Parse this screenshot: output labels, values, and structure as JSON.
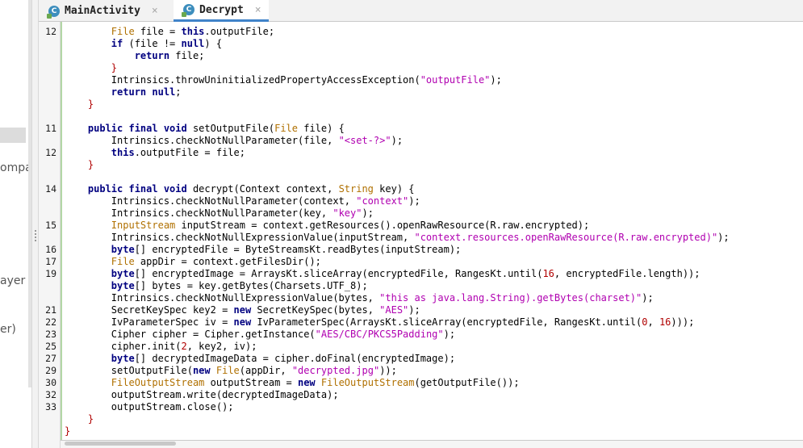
{
  "left_panel": {
    "fragments": [
      "ompa",
      "ayer",
      "er)"
    ]
  },
  "tabs": [
    {
      "label": "MainActivity",
      "close": "×",
      "active": false
    },
    {
      "label": "Decrypt",
      "close": "×",
      "active": true
    }
  ],
  "file_icon_letter": "C",
  "gutter_numbers": [
    {
      "n": "12",
      "line": 0
    },
    {
      "n": "11",
      "line": 8
    },
    {
      "n": "12",
      "line": 10
    },
    {
      "n": "14",
      "line": 13
    },
    {
      "n": "15",
      "line": 16
    },
    {
      "n": "16",
      "line": 18
    },
    {
      "n": "17",
      "line": 19
    },
    {
      "n": "19",
      "line": 20
    },
    {
      "n": "21",
      "line": 23
    },
    {
      "n": "22",
      "line": 24
    },
    {
      "n": "23",
      "line": 25
    },
    {
      "n": "25",
      "line": 26
    },
    {
      "n": "27",
      "line": 27
    },
    {
      "n": "29",
      "line": 28
    },
    {
      "n": "30",
      "line": 29
    },
    {
      "n": "32",
      "line": 30
    },
    {
      "n": "33",
      "line": 31
    }
  ],
  "code_lines": [
    [
      [
        "ty",
        "        File"
      ],
      [
        "t",
        " file = "
      ],
      [
        "kw",
        "this"
      ],
      [
        "t",
        ".outputFile;"
      ]
    ],
    [
      [
        "kw",
        "        if"
      ],
      [
        "t",
        " ("
      ],
      [
        "t",
        "file != "
      ],
      [
        "kw",
        "null"
      ],
      [
        "t",
        ") {"
      ]
    ],
    [
      [
        "kw",
        "            return"
      ],
      [
        "t",
        " file;"
      ]
    ],
    [
      [
        "br",
        "        }"
      ]
    ],
    [
      [
        "t",
        "        Intrinsics.throwUninitializedPropertyAccessException("
      ],
      [
        "st",
        "\"outputFile\""
      ],
      [
        "t",
        ");"
      ]
    ],
    [
      [
        "kw",
        "        return"
      ],
      [
        "t",
        " "
      ],
      [
        "kw",
        "null"
      ],
      [
        "t",
        ";"
      ]
    ],
    [
      [
        "br",
        "    }"
      ]
    ],
    [
      [
        "t",
        ""
      ]
    ],
    [
      [
        "kw",
        "    public final void"
      ],
      [
        "t",
        " setOutputFile("
      ],
      [
        "ty",
        "File"
      ],
      [
        "t",
        " file) {"
      ]
    ],
    [
      [
        "t",
        "        Intrinsics.checkNotNullParameter(file, "
      ],
      [
        "st",
        "\"<set-?>\""
      ],
      [
        "t",
        ");"
      ]
    ],
    [
      [
        "kw",
        "        this"
      ],
      [
        "t",
        ".outputFile = file;"
      ]
    ],
    [
      [
        "br",
        "    }"
      ]
    ],
    [
      [
        "t",
        ""
      ]
    ],
    [
      [
        "kw",
        "    public final void"
      ],
      [
        "t",
        " decrypt(Context context, "
      ],
      [
        "ty",
        "String"
      ],
      [
        "t",
        " key) {"
      ]
    ],
    [
      [
        "t",
        "        Intrinsics.checkNotNullParameter(context, "
      ],
      [
        "st",
        "\"context\""
      ],
      [
        "t",
        ");"
      ]
    ],
    [
      [
        "t",
        "        Intrinsics.checkNotNullParameter(key, "
      ],
      [
        "st",
        "\"key\""
      ],
      [
        "t",
        ");"
      ]
    ],
    [
      [
        "ty",
        "        InputStream"
      ],
      [
        "t",
        " inputStream = context.getResources().openRawResource(R.raw.encrypted);"
      ]
    ],
    [
      [
        "t",
        "        Intrinsics.checkNotNullExpressionValue(inputStream, "
      ],
      [
        "st",
        "\"context.resources.openRawResource(R.raw.encrypted)\""
      ],
      [
        "t",
        ");"
      ]
    ],
    [
      [
        "kw",
        "        byte"
      ],
      [
        "t",
        "[] encryptedFile = ByteStreamsKt.readBytes(inputStream);"
      ]
    ],
    [
      [
        "ty",
        "        File"
      ],
      [
        "t",
        " appDir = context.getFilesDir();"
      ]
    ],
    [
      [
        "kw",
        "        byte"
      ],
      [
        "t",
        "[] encryptedImage = ArraysKt.sliceArray(encryptedFile, RangesKt.until("
      ],
      [
        "br",
        "16"
      ],
      [
        "t",
        ", encryptedFile.length));"
      ]
    ],
    [
      [
        "kw",
        "        byte"
      ],
      [
        "t",
        "[] bytes = key.getBytes(Charsets.UTF_8);"
      ]
    ],
    [
      [
        "t",
        "        Intrinsics.checkNotNullExpressionValue(bytes, "
      ],
      [
        "st",
        "\"this as java.lang.String).getBytes(charset)\""
      ],
      [
        "t",
        ");"
      ]
    ],
    [
      [
        "t",
        "        SecretKeySpec key2 = "
      ],
      [
        "kw",
        "new"
      ],
      [
        "t",
        " SecretKeySpec(bytes, "
      ],
      [
        "st",
        "\"AES\""
      ],
      [
        "t",
        ");"
      ]
    ],
    [
      [
        "t",
        "        IvParameterSpec iv = "
      ],
      [
        "kw",
        "new"
      ],
      [
        "t",
        " IvParameterSpec(ArraysKt.sliceArray(encryptedFile, RangesKt.until("
      ],
      [
        "br",
        "0"
      ],
      [
        "t",
        ", "
      ],
      [
        "br",
        "16"
      ],
      [
        "t",
        ")));"
      ]
    ],
    [
      [
        "t",
        "        Cipher cipher = Cipher.getInstance("
      ],
      [
        "st",
        "\"AES/CBC/PKCS5Padding\""
      ],
      [
        "t",
        ");"
      ]
    ],
    [
      [
        "t",
        "        cipher.init("
      ],
      [
        "br",
        "2"
      ],
      [
        "t",
        ", key2, iv);"
      ]
    ],
    [
      [
        "kw",
        "        byte"
      ],
      [
        "t",
        "[] decryptedImageData = cipher.doFinal(encryptedImage);"
      ]
    ],
    [
      [
        "t",
        "        setOutputFile("
      ],
      [
        "kw",
        "new"
      ],
      [
        "t",
        " "
      ],
      [
        "ty",
        "File"
      ],
      [
        "t",
        "(appDir, "
      ],
      [
        "st",
        "\"decrypted.jpg\""
      ],
      [
        "t",
        "));"
      ]
    ],
    [
      [
        "ty",
        "        FileOutputStream"
      ],
      [
        "t",
        " outputStream = "
      ],
      [
        "kw",
        "new"
      ],
      [
        "t",
        " "
      ],
      [
        "ty",
        "FileOutputStream"
      ],
      [
        "t",
        "(getOutputFile());"
      ]
    ],
    [
      [
        "t",
        "        outputStream.write(decryptedImageData);"
      ]
    ],
    [
      [
        "t",
        "        outputStream.close();"
      ]
    ],
    [
      [
        "br",
        "    }"
      ]
    ],
    [
      [
        "br",
        "}"
      ]
    ]
  ]
}
